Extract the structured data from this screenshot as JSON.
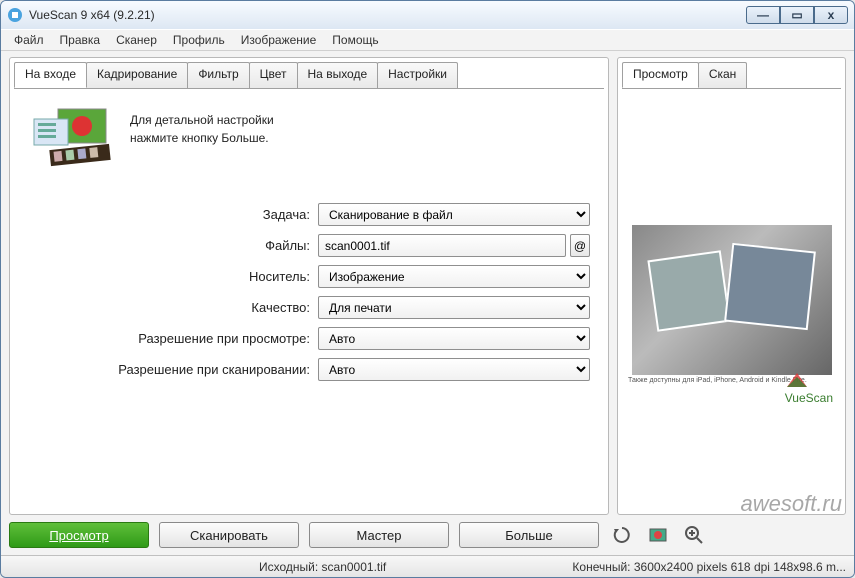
{
  "window": {
    "title": "VueScan 9 x64 (9.2.21)"
  },
  "menu": {
    "file": "Файл",
    "edit": "Правка",
    "scanner": "Сканер",
    "profile": "Профиль",
    "image": "Изображение",
    "help": "Помощь"
  },
  "left_tabs": [
    "На входе",
    "Кадрирование",
    "Фильтр",
    "Цвет",
    "На выходе",
    "Настройки"
  ],
  "right_tabs": [
    "Просмотр",
    "Скан"
  ],
  "intro": {
    "line1": "Для детальной настройки",
    "line2": "нажмите кнопку Больше."
  },
  "form": {
    "task": {
      "label": "Задача:",
      "value": "Сканирование в файл"
    },
    "files": {
      "label": "Файлы:",
      "value": "scan0001.tif",
      "at": "@"
    },
    "media": {
      "label": "Носитель:",
      "value": "Изображение"
    },
    "quality": {
      "label": "Качество:",
      "value": "Для печати"
    },
    "preview_res": {
      "label": "Разрешение при просмотре:",
      "value": "Авто"
    },
    "scan_res": {
      "label": "Разрешение при сканировании:",
      "value": "Авто"
    }
  },
  "preview": {
    "caption": "Также доступны для iPad, iPhone, Android и Kindle Fire.",
    "logo": "VueScan"
  },
  "buttons": {
    "preview": "Просмотр",
    "scan": "Сканировать",
    "wizard": "Мастер",
    "more": "Больше"
  },
  "status": {
    "source": "Исходный: scan0001.tif",
    "target": "Конечный: 3600x2400 pixels 618 dpi 148x98.6 m..."
  },
  "watermark": "awesoft.ru"
}
